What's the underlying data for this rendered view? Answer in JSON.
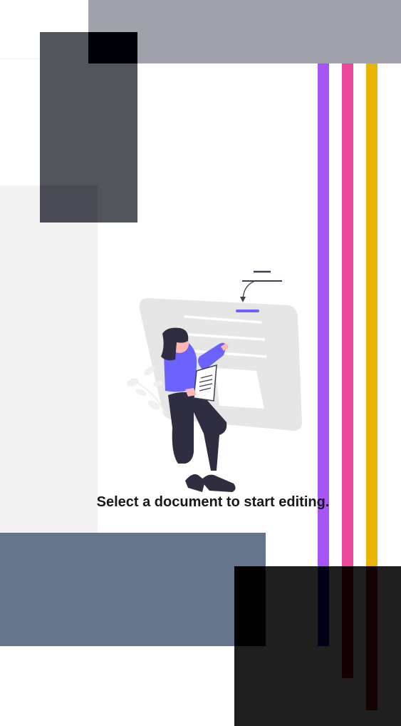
{
  "empty_state": {
    "message": "Select a document to start editing.",
    "illustration": "person-holding-document-illustration"
  },
  "colors": {
    "accent": "#6c63ff",
    "purple": "#a855f7",
    "pink": "#ec4899",
    "yellow": "#eab308",
    "slate": "#64748b",
    "dark": "#1f1f1f",
    "text": "#18181b"
  }
}
